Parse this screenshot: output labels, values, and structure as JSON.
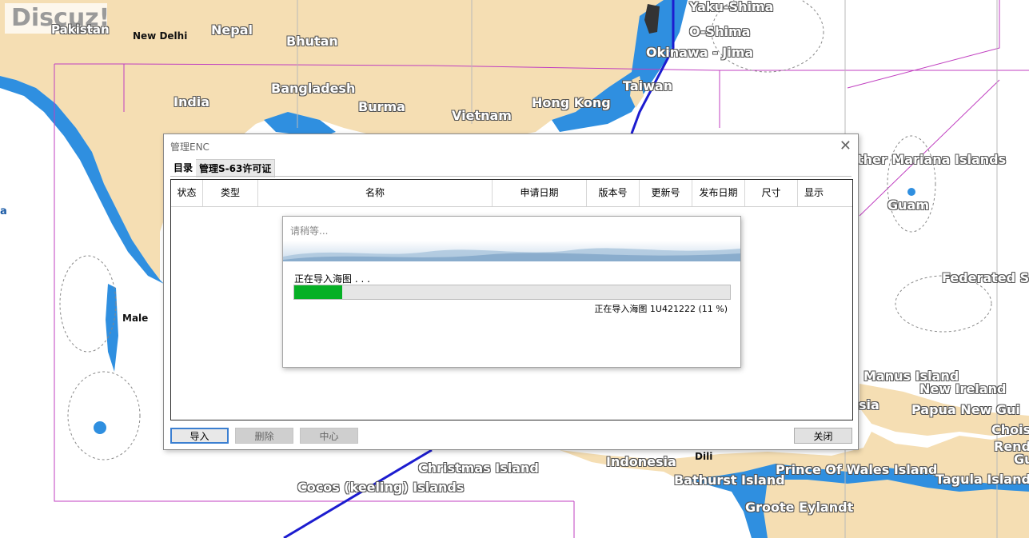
{
  "watermark": "Discuz!",
  "map_labels": {
    "pakistan": "Pakistan",
    "new_delhi": "New Delhi",
    "nepal": "Nepal",
    "bhutan": "Bhutan",
    "bangladesh": "Bangladesh",
    "india": "India",
    "burma": "Burma",
    "vietnam": "Vietnam",
    "hong_kong": "Hong Kong",
    "taiwan": "Taiwan",
    "yaku_shima": "Yaku-Shima",
    "o_shima": "O-Shima",
    "okinawa": "Okinawa - Jima",
    "mariana": "ther Mariana Islands",
    "guam": "Guam",
    "federated": "Federated S",
    "male": "Male",
    "left_a": "a",
    "manus": "Manus Island",
    "new_ireland": "New Ireland",
    "papua": "Papua New Gui",
    "chois": "Chois",
    "rend": "Rend",
    "gu": "Gu",
    "sia": "sia",
    "christmas": "Christmas Island",
    "indonesia": "Indonesia",
    "dili": "Dili",
    "prince_wales": "Prince Of Wales Island",
    "tagula": "Tagula Island",
    "cocos": "Cocos (keeling) Islands",
    "bathurst": "Bathurst Island",
    "groote": "Groote Eylandt"
  },
  "colors": {
    "land": "#f5deb3",
    "water_shallow": "#2f8fe0",
    "sea": "#ffffff",
    "progress": "#06b025",
    "accent": "#3b7fd1"
  },
  "dialog": {
    "title": "管理ENC",
    "close_icon": "close-icon",
    "tabs": [
      "目录",
      "管理S-63许可证"
    ],
    "columns": [
      "状态",
      "类型",
      "名称",
      "申请日期",
      "版本号",
      "更新号",
      "发布日期",
      "尺寸",
      "显示"
    ],
    "buttons": {
      "import": "导入",
      "delete": "删除",
      "center": "中心",
      "close": "关闭"
    }
  },
  "progress": {
    "title": "请稍等...",
    "message": "正在导入海图 . . .",
    "detail": "正在导入海图 1U421222 (11 %)",
    "percent": 11
  }
}
